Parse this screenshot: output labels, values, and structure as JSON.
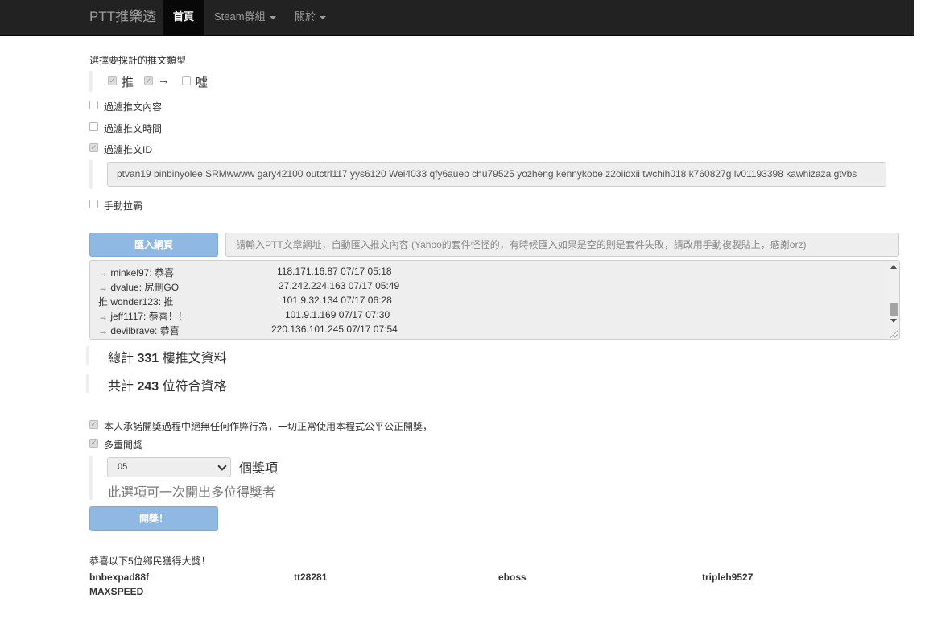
{
  "nav": {
    "brand": "PTT推樂透",
    "items": [
      {
        "label": "首頁"
      },
      {
        "label": "Steam群組"
      },
      {
        "label": "關於"
      }
    ]
  },
  "filter": {
    "heading": "選擇要採計的推文類型",
    "types": [
      {
        "label": "推",
        "checked": true
      },
      {
        "label": "→",
        "checked": true
      },
      {
        "label": "噓",
        "checked": false
      }
    ],
    "options": [
      {
        "label": "過濾推文內容",
        "checked": false
      },
      {
        "label": "過濾推文時間",
        "checked": false
      },
      {
        "label": "過濾推文ID",
        "checked": true
      }
    ],
    "id_filter_value": "ptvan19 binbinyolee SRMwwww gary42100 outctrl117 yys6120 Wei4033 qfy6auep chu79525 yozheng kennykobe z2oiidxii twchih018 k760827g lv01193398 kawhizaza gtvbs",
    "manual_label": "手動拉霸",
    "manual_checked": false
  },
  "import": {
    "button_label": "匯入網頁",
    "url_placeholder": "請輸入PTT文章網址，自動匯入推文內容 (Yahoo的套件怪怪的，有時候匯入如果是空的則是套件失敗，請改用手動複製貼上，感謝orz)"
  },
  "log": [
    {
      "text": "→ minkel97: 恭喜",
      "meta": "118.171.16.87 07/17 05:18"
    },
    {
      "text": "→ dvalue: 尻刪GO",
      "meta": "27.242.224.163 07/17 05:49"
    },
    {
      "text": "推 wonder123: 推",
      "meta": "101.9.32.134 07/17 06:28"
    },
    {
      "text": "→ jeff1117: 恭喜！！",
      "meta": "101.9.1.169 07/17 07:30"
    },
    {
      "text": "→ devilbrave: 恭喜",
      "meta": "220.136.101.245 07/17 07:54"
    }
  ],
  "stats": {
    "total_prefix": "總計",
    "total_count": "331",
    "total_suffix": "樓推文資料",
    "qualified_prefix": "共計",
    "qualified_count": "243",
    "qualified_suffix": "位符合資格"
  },
  "draw": {
    "promise_label": "本人承諾開獎過程中絕無任何作弊行為，一切正常使用本程式公平公正開獎，",
    "promise_checked": true,
    "multi_label": "多重開獎",
    "multi_checked": true,
    "prize_count": "05",
    "prize_unit": "個獎項",
    "multi_help": "此選項可一次開出多位得獎者",
    "button_label": "開獎！"
  },
  "results": {
    "heading": "恭喜以下5位鄉民獲得大獎！",
    "winners": [
      "bnbexpad88f",
      "tt28281",
      "eboss",
      "tripleh9527",
      "MAXSPEED"
    ]
  }
}
